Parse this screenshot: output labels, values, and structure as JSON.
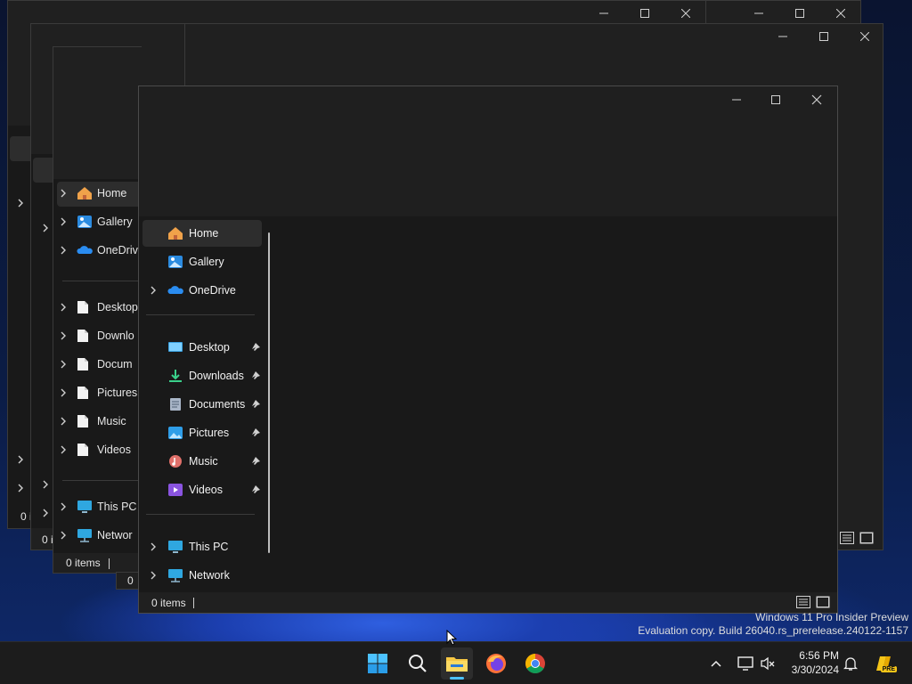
{
  "front_window": {
    "nav_items": [
      {
        "label": "Home",
        "selected": true
      },
      {
        "label": "Gallery"
      },
      {
        "label": "OneDrive",
        "expandable": true
      }
    ],
    "quick_access": [
      {
        "label": "Desktop",
        "pinned": true
      },
      {
        "label": "Downloads",
        "pinned": true
      },
      {
        "label": "Documents",
        "pinned": true
      },
      {
        "label": "Pictures",
        "pinned": true
      },
      {
        "label": "Music",
        "pinned": true
      },
      {
        "label": "Videos",
        "pinned": true
      }
    ],
    "devices": [
      {
        "label": "This PC"
      },
      {
        "label": "Network"
      }
    ],
    "status_text": "0 items"
  },
  "back_window": {
    "nav_items": [
      "Home",
      "Gallery",
      "OneDrive",
      "Desktop",
      "Downlo",
      "Docum",
      "Pictures",
      "Music",
      "Videos",
      "This PC",
      "Networ"
    ],
    "status_text": "0 items",
    "status_text_2": "0 i",
    "status_text_3": "0 i",
    "status_text_4": "0"
  },
  "watermark": {
    "line1": "Windows 11 Pro Insider Preview",
    "line2": "Evaluation copy. Build 26040.rs_prerelease.240122-1157"
  },
  "taskbar": {
    "time": "6:56 PM",
    "date": "3/30/2024",
    "apps": [
      "start-icon",
      "search-icon",
      "file-explorer-icon",
      "firefox-icon",
      "chrome-icon"
    ],
    "copilot_badge": "PRE"
  },
  "colors": {
    "accent": "#4cc2ff",
    "window_bg": "#202020",
    "nav_bg": "#191919"
  }
}
